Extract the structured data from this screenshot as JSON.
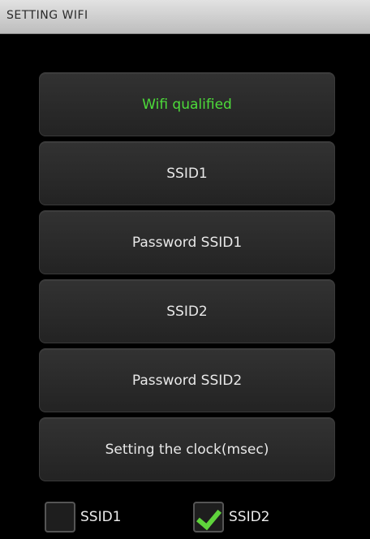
{
  "title_bar": {
    "title": "SETTING WIFI"
  },
  "menu": {
    "items": [
      {
        "label": "Wifi qualified",
        "accent_color": "#4ddc3a"
      },
      {
        "label": "SSID1"
      },
      {
        "label": "Password SSID1"
      },
      {
        "label": "SSID2"
      },
      {
        "label": "Password SSID2"
      },
      {
        "label": "Setting the clock(msec)"
      }
    ]
  },
  "checkboxes": [
    {
      "label": "SSID1",
      "checked": false
    },
    {
      "label": "SSID2",
      "checked": true,
      "check_color": "#5fd43c"
    }
  ]
}
